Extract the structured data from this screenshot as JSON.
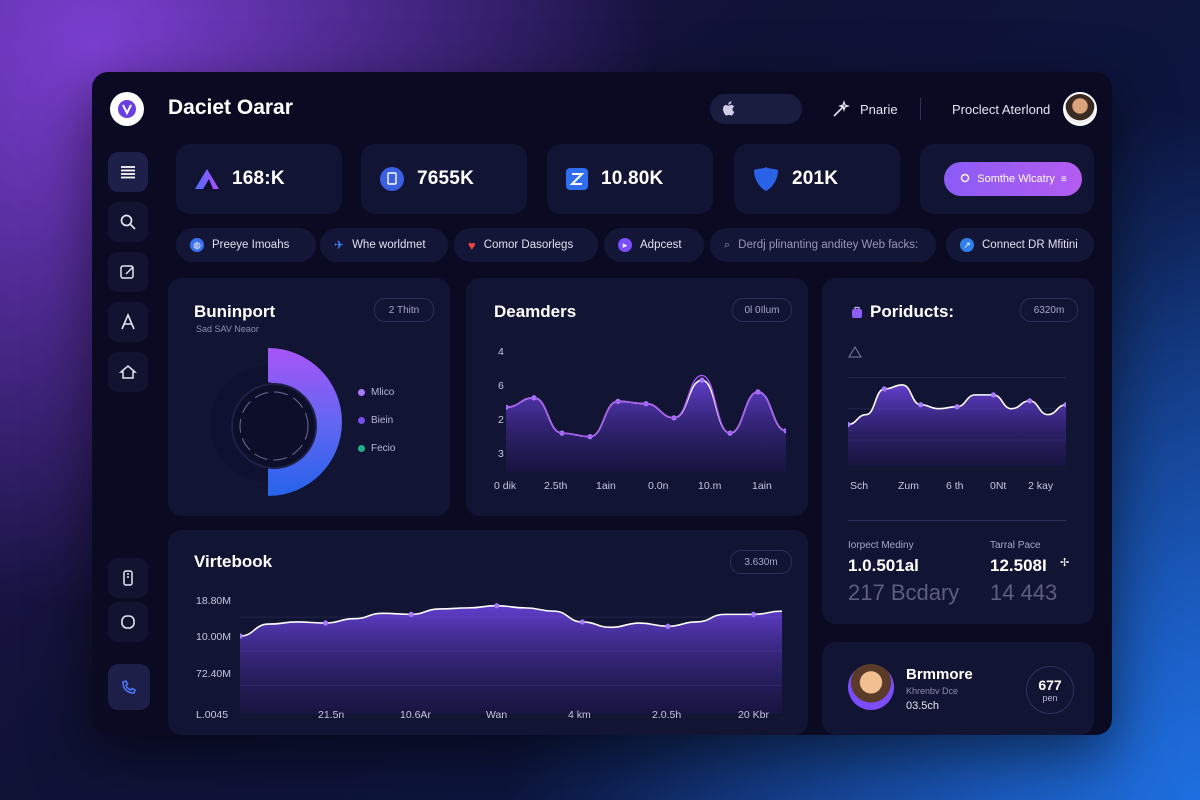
{
  "header": {
    "app_title": "Daciet Oarar",
    "nav_item": "Pnarie",
    "project": "Proclect Aterlond",
    "search_icon": "apple-icon"
  },
  "sidebar": {
    "items": [
      {
        "icon": "menu-icon"
      },
      {
        "icon": "search-icon"
      },
      {
        "icon": "edit-icon"
      },
      {
        "icon": "letter-a-icon"
      },
      {
        "icon": "home-icon"
      },
      {
        "icon": "phone-icon"
      },
      {
        "icon": "circle-icon"
      },
      {
        "icon": "call-icon"
      }
    ]
  },
  "stats": [
    {
      "value": "168:K",
      "icon": "triangle-icon",
      "color": "#7a4df0"
    },
    {
      "value": "7655K",
      "icon": "doc-icon",
      "color": "#3b5fe0"
    },
    {
      "value": "10.80K",
      "icon": "z-icon",
      "color": "#2f6ef0"
    },
    {
      "value": "201K",
      "icon": "shield-icon",
      "color": "#2a63e8"
    }
  ],
  "cta_button": "Somthe Wlcatry",
  "chips": [
    {
      "label": "Preeye Imoahs",
      "icon": "globe-icon",
      "color": "#3b6ff0"
    },
    {
      "label": "Whe worldmet",
      "icon": "plane-icon",
      "color": "#3b82f6"
    },
    {
      "label": "Comor Dasorlegs",
      "icon": "heart-icon",
      "color": "#ef4444"
    },
    {
      "label": "Adpcest",
      "icon": "play-icon",
      "color": "#7c4dff"
    },
    {
      "label": "Derdj plinanting anditey Web facks:",
      "icon": "search-icon",
      "color": "#6b6e99"
    },
    {
      "label": "Connect DR Mfitini",
      "icon": "link-icon",
      "color": "#2f80ed"
    }
  ],
  "donut_card": {
    "title": "Buninport",
    "subtitle": "Sad SAV Neaor",
    "pill": "2 Thitn",
    "legend": [
      {
        "label": "Mlico",
        "color": "#a77bff"
      },
      {
        "label": "Biein",
        "color": "#7a4df0"
      },
      {
        "label": "Fecio",
        "color": "#20b08a"
      }
    ]
  },
  "chart_data": [
    {
      "type": "area",
      "title": "Deamders",
      "pill": "0l 0Ilum",
      "y_ticks": [
        "4",
        "6",
        "2",
        "3"
      ],
      "x_ticks": [
        "0 dik",
        "2.5th",
        "1ain",
        "0.0n",
        "10.m",
        "1ain"
      ],
      "series": [
        {
          "values": [
            0.55,
            0.63,
            0.33,
            0.3,
            0.6,
            0.58,
            0.46,
            0.78,
            0.33,
            0.68,
            0.35
          ]
        },
        {
          "values": [
            0.55,
            0.63,
            0.33,
            0.3,
            0.6,
            0.58,
            0.46,
            0.82,
            0.33,
            0.68,
            0.35
          ]
        }
      ]
    },
    {
      "type": "area",
      "title": "Poriducts:",
      "pill": "6320m",
      "x_ticks": [
        "Sch",
        "Zum",
        "6 th",
        "0Nt",
        "2 kay"
      ],
      "series": [
        {
          "values": [
            0.42,
            0.52,
            0.78,
            0.82,
            0.62,
            0.58,
            0.6,
            0.72,
            0.72,
            0.58,
            0.66,
            0.52,
            0.62
          ]
        }
      ]
    },
    {
      "type": "area",
      "title": "Virtebook",
      "pill": "3.630m",
      "y_ticks": [
        "18.80M",
        "10.00M",
        "72.40M",
        "L.0045"
      ],
      "x_ticks": [
        "21.5n",
        "10.6Ar",
        "Wan",
        "4 km",
        "2.0.5h",
        "20 Kbr"
      ],
      "series": [
        {
          "values": [
            0.72,
            0.83,
            0.85,
            0.84,
            0.88,
            0.93,
            0.92,
            0.97,
            0.98,
            1.0,
            0.98,
            0.95,
            0.85,
            0.8,
            0.84,
            0.81,
            0.85,
            0.92,
            0.92,
            0.95
          ]
        }
      ]
    }
  ],
  "products_stats": {
    "label1": "Iorpect Mediny",
    "value1": "1.0.501al",
    "big1": "217 Bcdary",
    "label2": "Tarral Pace",
    "value2": "12.508I",
    "big2": "14 443"
  },
  "profile": {
    "name": "Brmmore",
    "sub": "Khrenbv Dce",
    "time": "03.5ch",
    "badge_top": "677",
    "badge_bottom": "pen"
  }
}
